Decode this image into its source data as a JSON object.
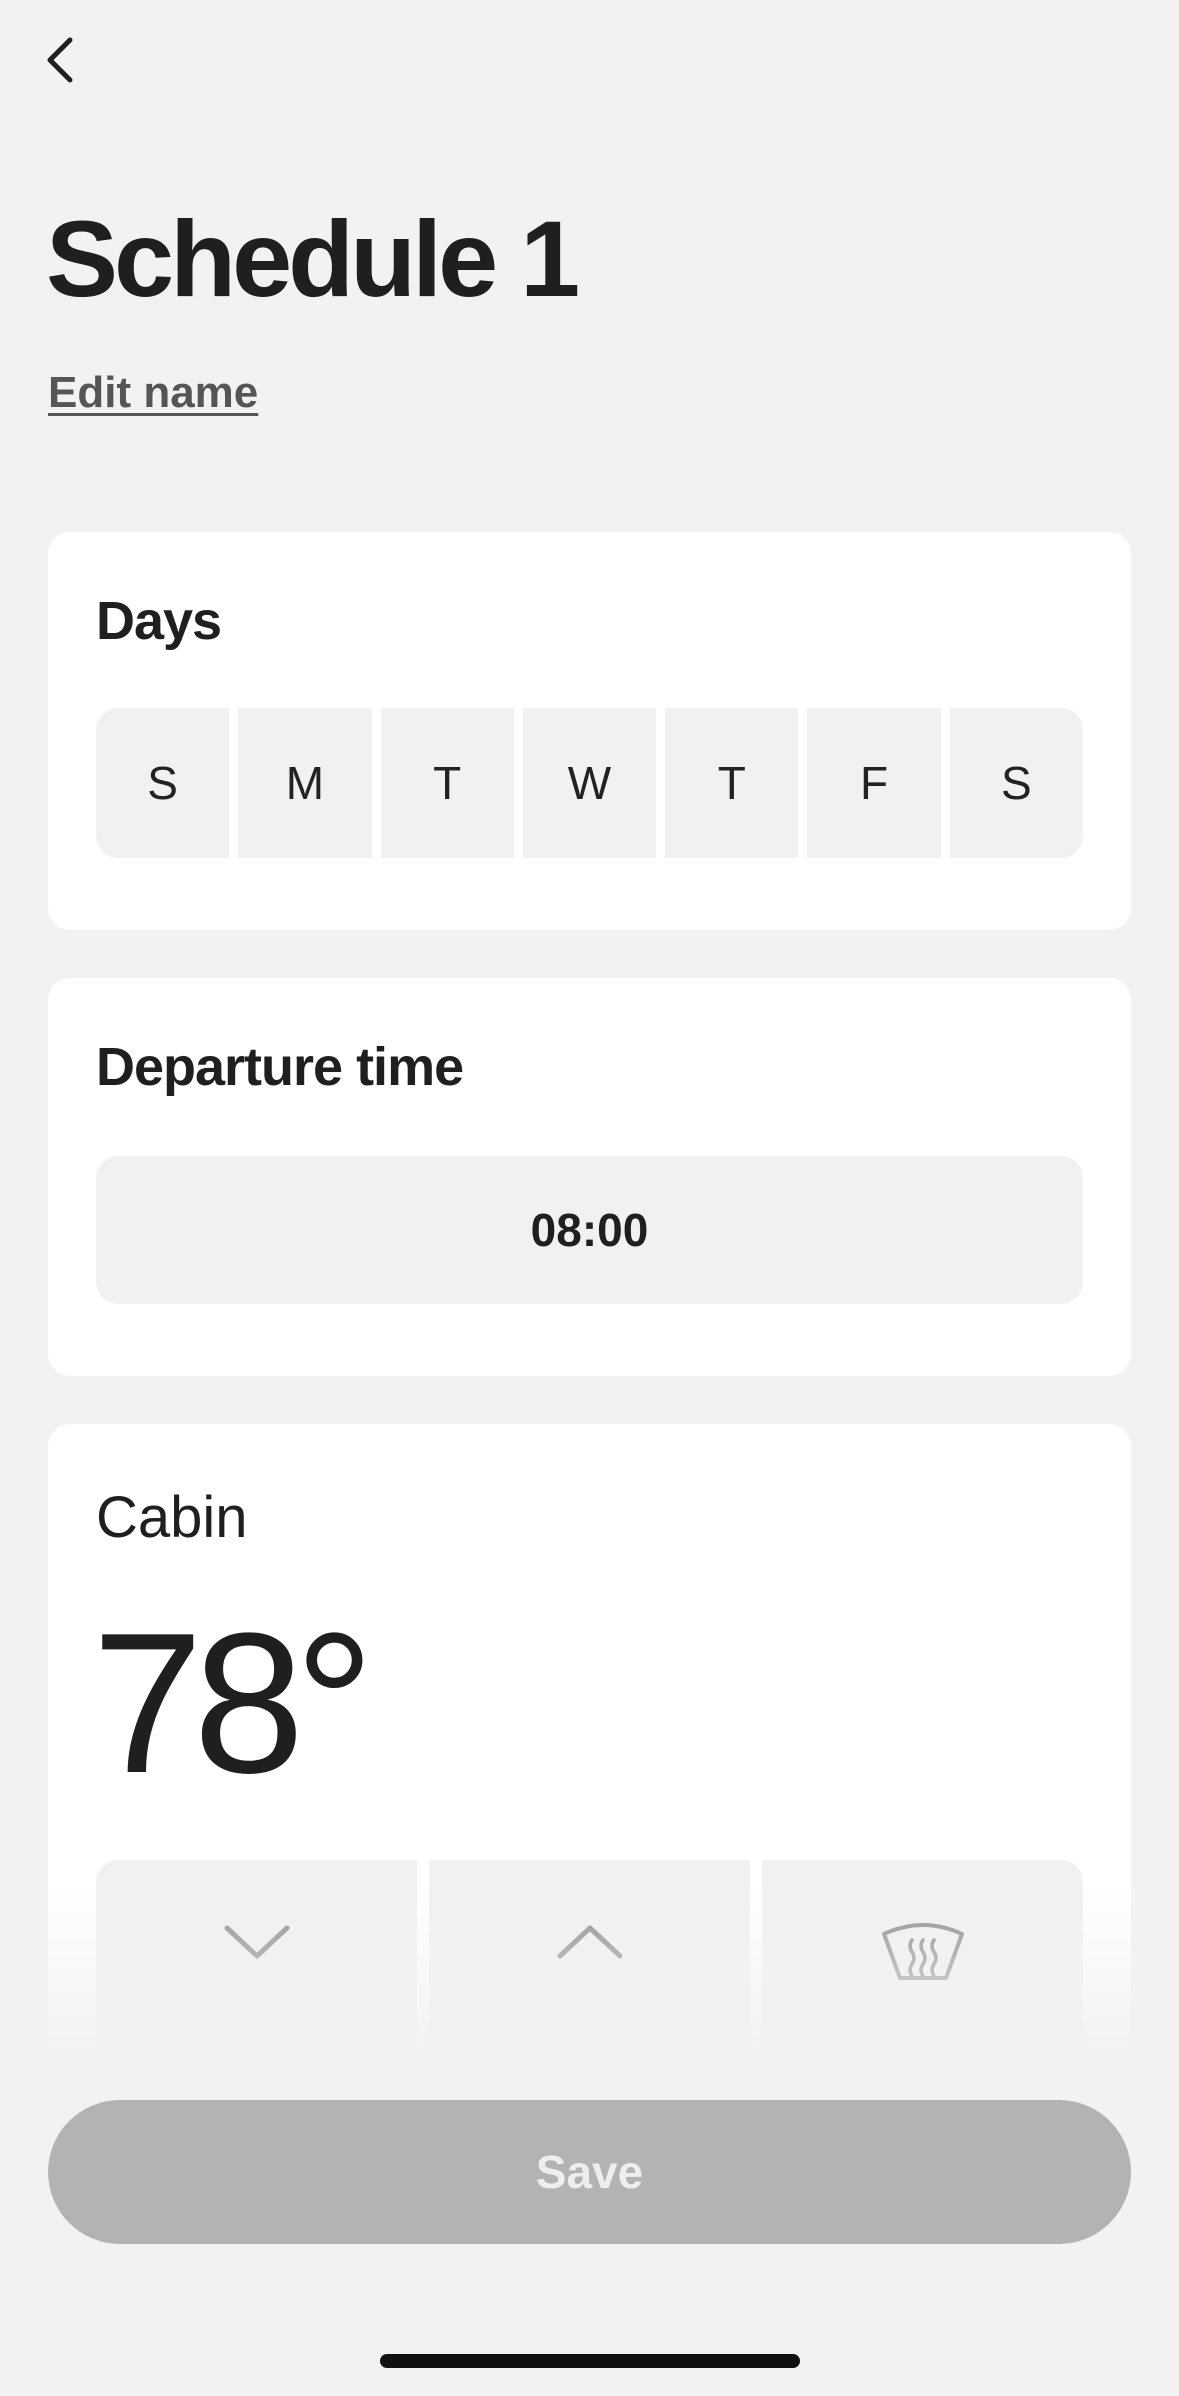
{
  "header": {
    "back_icon": "chevron-left-icon",
    "title": "Schedule 1",
    "edit_name_label": "Edit name"
  },
  "days": {
    "heading": "Days",
    "items": [
      {
        "label": "S"
      },
      {
        "label": "M"
      },
      {
        "label": "T"
      },
      {
        "label": "W"
      },
      {
        "label": "T"
      },
      {
        "label": "F"
      },
      {
        "label": "S"
      }
    ]
  },
  "departure": {
    "heading": "Departure time",
    "value": "08:00"
  },
  "cabin": {
    "label": "Cabin",
    "temperature": "78°",
    "controls": [
      {
        "icon": "chevron-down-icon"
      },
      {
        "icon": "chevron-up-icon"
      },
      {
        "icon": "windshield-defrost-icon"
      }
    ]
  },
  "footer": {
    "save_label": "Save"
  },
  "colors": {
    "background": "#f2f2f2",
    "card": "#ffffff",
    "button_fill": "#f1f1f1",
    "save_disabled": "#b3b3b3",
    "text": "#1f1f1f"
  }
}
